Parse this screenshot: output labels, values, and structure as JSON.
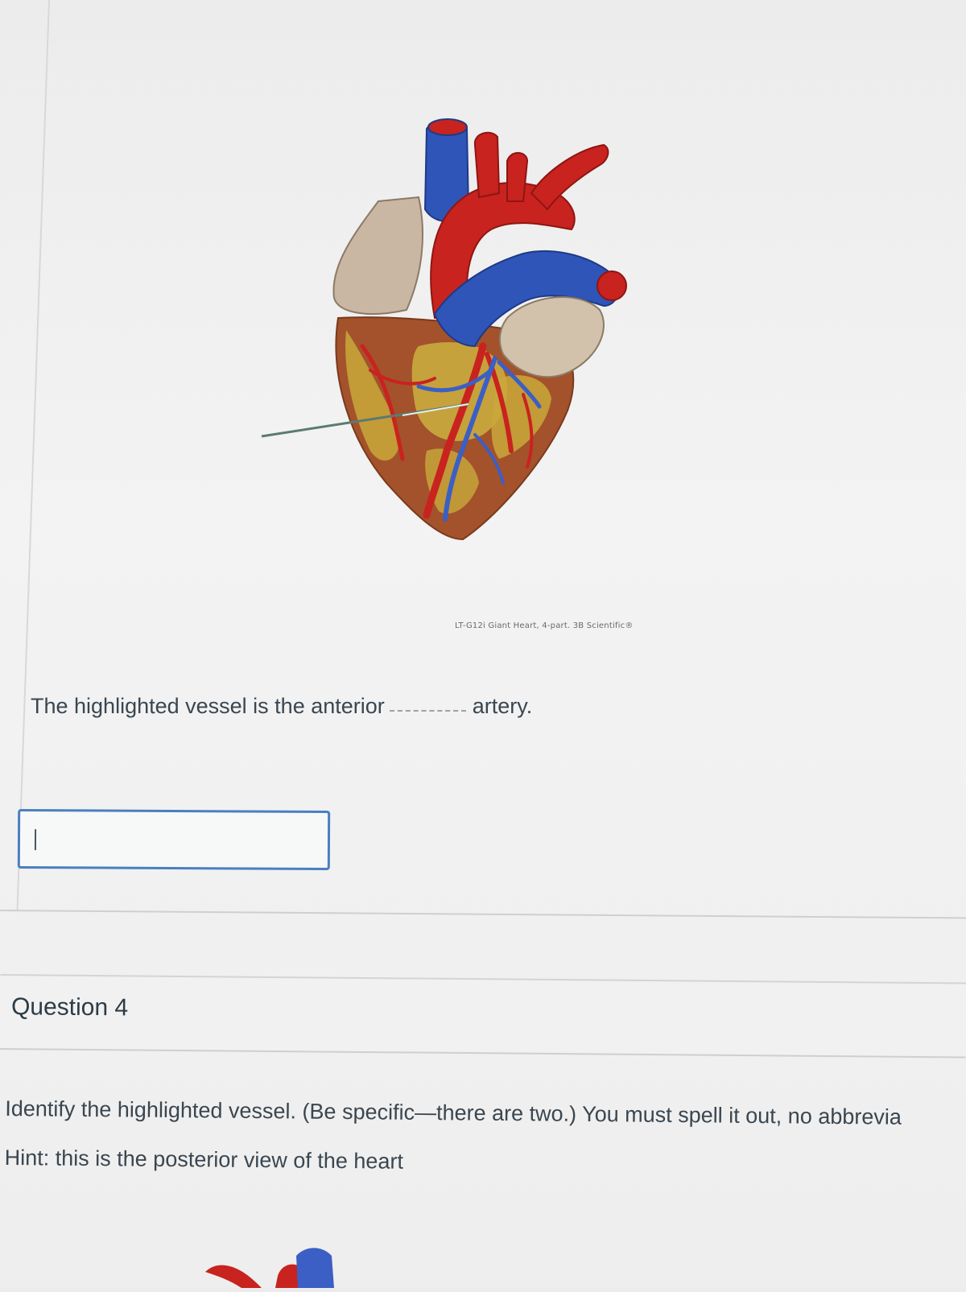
{
  "question3": {
    "image_caption": "LT-G12i Giant Heart, 4-part. 3B Scientific®",
    "prompt_before": "The highlighted vessel is the anterior",
    "prompt_after": "artery.",
    "answer_value": ""
  },
  "question4": {
    "title": "Question 4",
    "prompt": "Identify the highlighted vessel. (Be specific—there are two.) You must spell it out, no abbrevia",
    "hint": "Hint: this is the posterior view of the heart"
  },
  "colors": {
    "input_border": "#4a7fc1",
    "text": "#3a4650",
    "artery_red": "#c8231f",
    "vein_blue": "#2f55b8",
    "fat_yellow": "#c9a83a"
  }
}
